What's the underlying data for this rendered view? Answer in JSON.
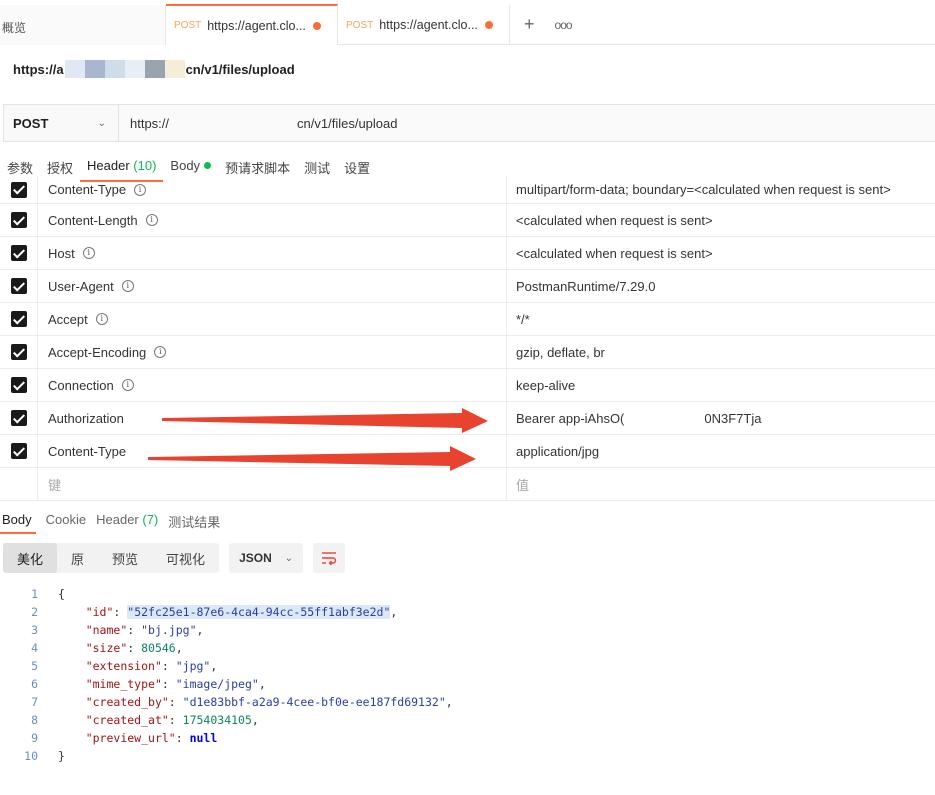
{
  "tabs": {
    "overview": "概览",
    "items": [
      {
        "method": "POST",
        "label": "https://agent.clo..."
      },
      {
        "method": "POST",
        "label": "https://agent.clo..."
      }
    ],
    "new_tab": "+",
    "more": "ooo"
  },
  "request": {
    "title_prefix": "https://a",
    "title_suffix": "cn/v1/files/upload",
    "method": "POST",
    "url_prefix": "https://",
    "url_suffix": "cn/v1/files/upload"
  },
  "request_tabs": [
    {
      "label": "参数"
    },
    {
      "label": "授权"
    },
    {
      "label": "Header",
      "count": "(10)"
    },
    {
      "label": "Body"
    },
    {
      "label": "预请求脚本"
    },
    {
      "label": "测试"
    },
    {
      "label": "设置"
    }
  ],
  "headers": [
    {
      "key": "Content-Type",
      "value": "multipart/form-data; boundary=<calculated when request is sent>",
      "info": "i"
    },
    {
      "key": "Content-Length",
      "value": "<calculated when request is sent>",
      "info": "i"
    },
    {
      "key": "Host",
      "value": "<calculated when request is sent>",
      "info": "i"
    },
    {
      "key": "User-Agent",
      "value": "PostmanRuntime/7.29.0",
      "info": "i"
    },
    {
      "key": "Accept",
      "value": "*/*",
      "info": "i"
    },
    {
      "key": "Accept-Encoding",
      "value": "gzip, deflate, br",
      "info": "i"
    },
    {
      "key": "Connection",
      "value": "keep-alive",
      "info": "i"
    },
    {
      "key": "Authorization",
      "value_prefix": "Bearer app-iAhsO(",
      "value_suffix": "0N3F7Tja"
    },
    {
      "key": "Content-Type",
      "value": "application/jpg"
    }
  ],
  "new_header": {
    "key_placeholder": "键",
    "value_placeholder": "值"
  },
  "response_tabs": [
    {
      "label": "Body"
    },
    {
      "label": "Cookie"
    },
    {
      "label": "Header",
      "count": "(7)"
    },
    {
      "label": "测试结果"
    }
  ],
  "view_modes": [
    "美化",
    "原",
    "预览",
    "可视化"
  ],
  "format": "JSON",
  "response_body": {
    "line_numbers": [
      "1",
      "2",
      "3",
      "4",
      "5",
      "6",
      "7",
      "8",
      "9",
      "10"
    ],
    "open": "{",
    "close": "}",
    "fields": [
      {
        "key": "\"id\"",
        "value": "\"52fc25e1-87e6-4ca4-94cc-55ff1abf3e2d\"",
        "kind": "string"
      },
      {
        "key": "\"name\"",
        "value": "\"bj.jpg\"",
        "kind": "string"
      },
      {
        "key": "\"size\"",
        "value": "80546",
        "kind": "number"
      },
      {
        "key": "\"extension\"",
        "value": "\"jpg\"",
        "kind": "string"
      },
      {
        "key": "\"mime_type\"",
        "value": "\"image/jpeg\"",
        "kind": "string"
      },
      {
        "key": "\"created_by\"",
        "value": "\"d1e83bbf-a2a9-4cee-bf0e-ee187fd69132\"",
        "kind": "string"
      },
      {
        "key": "\"created_at\"",
        "value": "1754034105",
        "kind": "number"
      },
      {
        "key": "\"preview_url\"",
        "value": "null",
        "kind": "keyword"
      }
    ]
  },
  "colors": {
    "accent": "#ff6c37",
    "success": "#0cbb52",
    "arrow": "#e8432e"
  },
  "icons": {
    "info": "info-icon",
    "checkbox": "checkbox-checked-icon",
    "chevron": "chevron-down-icon",
    "wrap": "wrap-lines-icon",
    "plus": "plus-icon",
    "more": "more-icon"
  }
}
